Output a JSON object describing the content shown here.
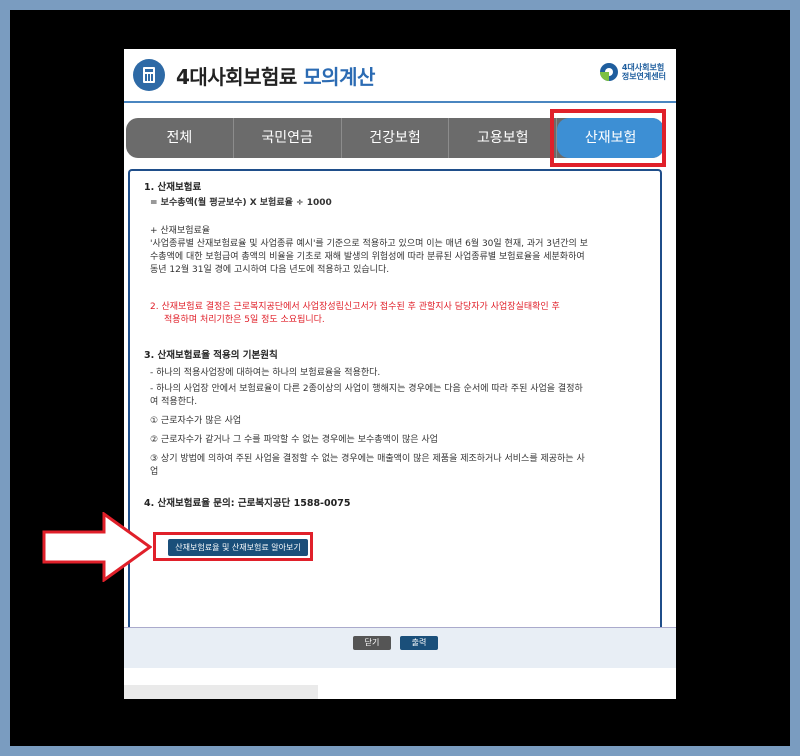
{
  "header": {
    "title_main": "4대사회보험료 ",
    "title_accent": "모의계산",
    "logo_line1": "4대사회보험",
    "logo_line2": "정보연계센터"
  },
  "tabs": [
    {
      "label": "전체"
    },
    {
      "label": "국민연금"
    },
    {
      "label": "건강보험"
    },
    {
      "label": "고용보험"
    },
    {
      "label": "산재보험"
    }
  ],
  "content": {
    "s1_title": "1. 산재보험료",
    "s1_formula": "= 보수총액(월 평균보수) X 보험료율 ÷ 1000",
    "s1_note_title": "+ 산재보험료율",
    "s1_note_l1": "'사업종류별 산재보험료율 및 사업종류 예시'를 기준으로 적용하고 있으며 이는 매년 6월 30일 현재, 과거 3년간의 보",
    "s1_note_l2": "수총액에 대한 보험급여 총액의 비율을 기초로 재해 발생의 위험성에 따라 분류된 사업종류별 보험료율을 세분화하여",
    "s1_note_l3": "동년 12월 31일 경에 고시하여 다음 년도에 적용하고 있습니다.",
    "s2_l1": "2. 산재보험료 결정은 근로복지공단에서 사업장성립신고서가 접수된 후 관할지사 담당자가 사업장실태확인 후",
    "s2_l2": "적용하며 처리기한은 5일 정도 소요됩니다.",
    "s3_title": "3. 산재보험료율 적용의 기본원칙",
    "s3_l1": "- 하나의 적용사업장에 대하여는 하나의 보험료율을 적용한다.",
    "s3_l2": "- 하나의 사업장 안에서 보험료율이 다른 2종이상의 사업이 행해지는 경우에는 다음 순서에 따라 주된 사업을 결정하",
    "s3_l3": "여 적용한다.",
    "s3_i1": "① 근로자수가 많은 사업",
    "s3_i2": "② 근로자수가 같거나 그 수를 파악할 수 없는 경우에는 보수총액이 많은 사업",
    "s3_i3a": "③ 상기 방법에 의하여 주된 사업을 결정할 수 없는 경우에는 매출액이 많은 제품을 제조하거나 서비스를 제공하는 사",
    "s3_i3b": "업",
    "s4_title": "4. 산재보험료율 문의: 근로복지공단 1588-0075",
    "info_button": "산재보험료율 및 산재보험료 알아보기"
  },
  "footer": {
    "close_label": "닫기",
    "print_label": "출력"
  },
  "colors": {
    "accent": "#3d8fd4",
    "highlight": "#e0202a",
    "tabbar": "#6b6b6b"
  }
}
